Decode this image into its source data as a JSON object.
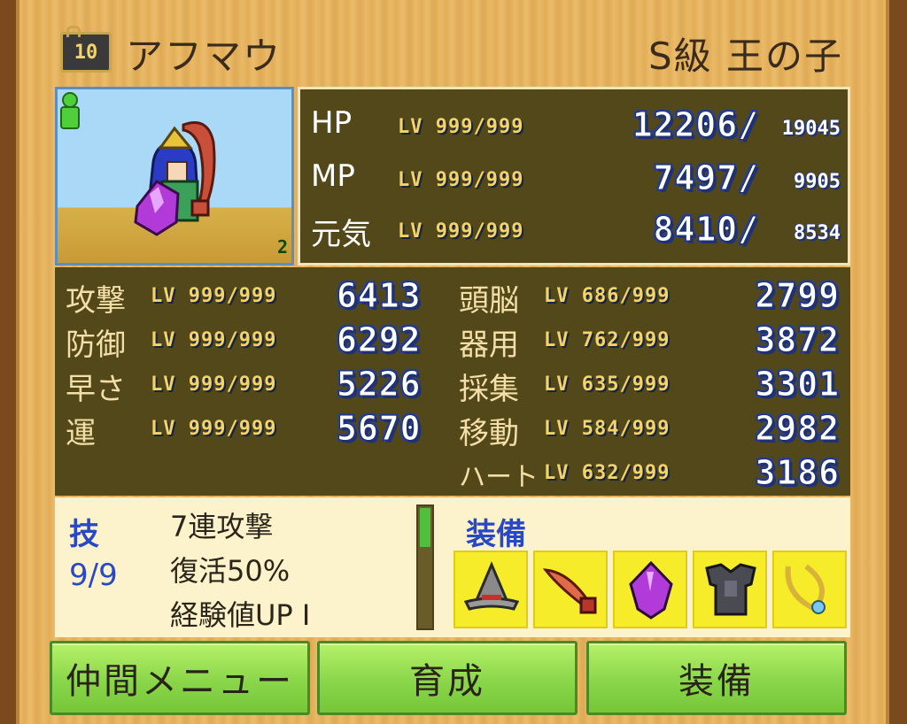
{
  "header": {
    "level_badge": "10",
    "name": "アフマウ",
    "rank": "S級  王の子"
  },
  "portrait": {
    "friend_count": "2"
  },
  "vitals": [
    {
      "label": "HP",
      "lv": "LV 999/999",
      "value": "12206/",
      "max": "19045"
    },
    {
      "label": "MP",
      "lv": "LV 999/999",
      "value": "7497/",
      "max": "9905"
    },
    {
      "label": "元気",
      "lv": "LV 999/999",
      "value": "8410/",
      "max": "8534"
    }
  ],
  "stats_left": [
    {
      "label": "攻撃",
      "lv": "LV 999/999",
      "value": "6413"
    },
    {
      "label": "防御",
      "lv": "LV 999/999",
      "value": "6292"
    },
    {
      "label": "早さ",
      "lv": "LV 999/999",
      "value": "5226"
    },
    {
      "label": "運",
      "lv": "LV 999/999",
      "value": "5670"
    }
  ],
  "stats_right": [
    {
      "label": "頭脳",
      "lv": "LV 686/999",
      "value": "2799"
    },
    {
      "label": "器用",
      "lv": "LV 762/999",
      "value": "3872"
    },
    {
      "label": "採集",
      "lv": "LV 635/999",
      "value": "3301"
    },
    {
      "label": "移動",
      "lv": "LV 584/999",
      "value": "2982"
    },
    {
      "label": "ハート",
      "lv": "LV 632/999",
      "value": "3186"
    }
  ],
  "skills": {
    "heading": "技",
    "count": "9/9",
    "items": [
      "7連攻撃",
      "復活50%",
      "経験値UP I"
    ]
  },
  "equipment": {
    "heading": "装備",
    "icons": [
      "wizard-hat-icon",
      "feather-blade-icon",
      "purple-gem-icon",
      "dark-armor-icon",
      "gold-necklace-icon"
    ]
  },
  "buttons": {
    "party_menu": "仲間メニュー",
    "training": "育成",
    "equip": "装備"
  },
  "colors": {
    "panel_dark": "#534819",
    "wood": "#e8b866",
    "button_green": "#8ad64a",
    "skill_blue": "#2848c8",
    "lv_yellow": "#f4d36b"
  }
}
